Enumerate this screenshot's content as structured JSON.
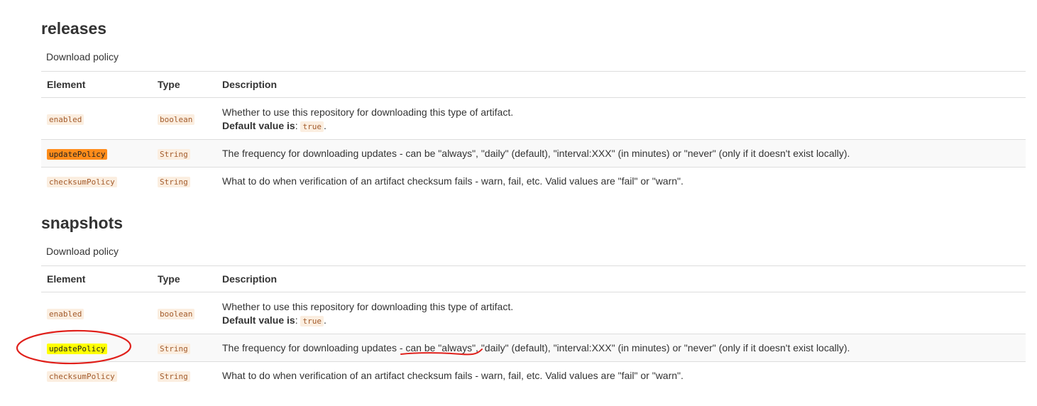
{
  "sections": [
    {
      "title": "releases",
      "caption": "Download policy",
      "headers": {
        "element": "Element",
        "type": "Type",
        "description": "Description"
      },
      "rows": [
        {
          "element": "enabled",
          "type": "boolean",
          "description": "Whether to use this repository for downloading this type of artifact.",
          "default_label": "Default value is",
          "default_value": "true"
        },
        {
          "element": "updatePolicy",
          "type": "String",
          "description": "The frequency for downloading updates - can be \"always\", \"daily\" (default), \"interval:XXX\" (in minutes) or \"never\" (only if it doesn't exist locally)."
        },
        {
          "element": "checksumPolicy",
          "type": "String",
          "description": "What to do when verification of an artifact checksum fails - warn, fail, etc. Valid values are \"fail\" or \"warn\"."
        }
      ]
    },
    {
      "title": "snapshots",
      "caption": "Download policy",
      "headers": {
        "element": "Element",
        "type": "Type",
        "description": "Description"
      },
      "rows": [
        {
          "element": "enabled",
          "type": "boolean",
          "description": "Whether to use this repository for downloading this type of artifact.",
          "default_label": "Default value is",
          "default_value": "true"
        },
        {
          "element": "updatePolicy",
          "type": "String",
          "description": "The frequency for downloading updates - can be \"always\", \"daily\" (default), \"interval:XXX\" (in minutes) or \"never\" (only if it doesn't exist locally)."
        },
        {
          "element": "checksumPolicy",
          "type": "String",
          "description": "What to do when verification of an artifact checksum fails - warn, fail, etc. Valid values are \"fail\" or \"warn\"."
        }
      ]
    }
  ],
  "highlights": {
    "releases_update_policy": "#ff8c1a",
    "snapshots_update_policy": "#ffff00",
    "annotation": "#e0201b"
  }
}
